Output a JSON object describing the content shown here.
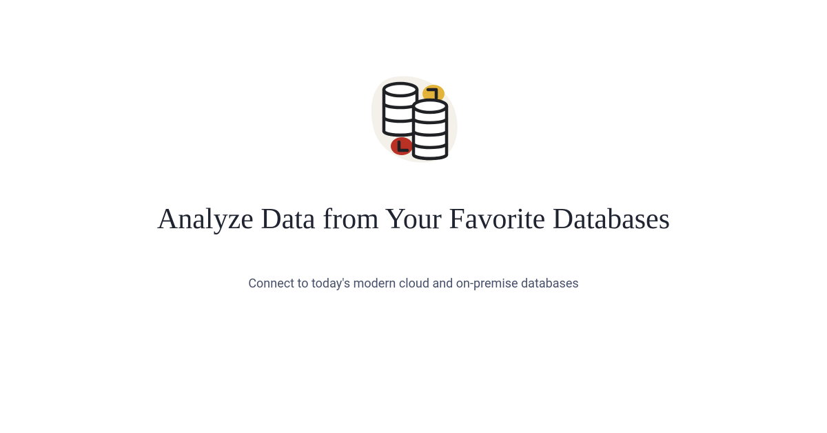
{
  "hero": {
    "headline": "Analyze Data from Your Favorite Databases",
    "subtitle": "Connect to today's modern cloud and on-premise databases"
  },
  "illustration": {
    "name": "database-sync-icon",
    "colors": {
      "bg_blob": "#f4f1ea",
      "blob_red": "#b93025",
      "blob_yellow": "#e4b43a",
      "stroke": "#1f2125",
      "cylinder_fill": "#ffffff"
    }
  }
}
